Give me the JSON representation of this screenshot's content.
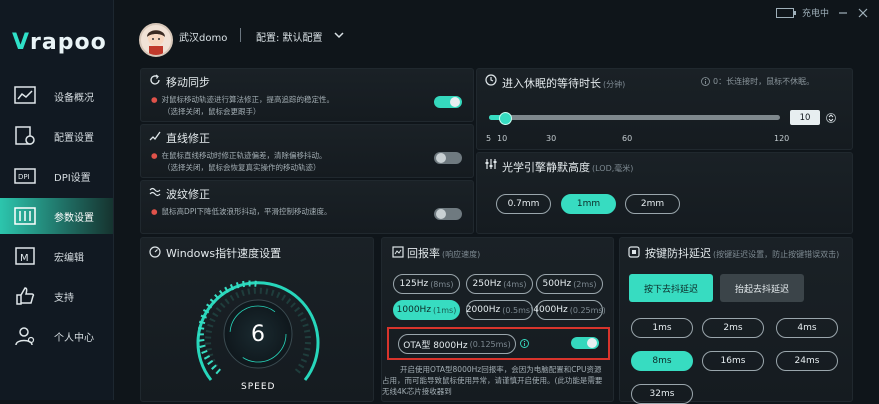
{
  "brand": {
    "logo": "rapoo",
    "logo_v": "V"
  },
  "topbar": {
    "battery_text": "充电中"
  },
  "header": {
    "username": "武汉domo",
    "config_label": "配置: 默认配置"
  },
  "sidebar": {
    "items": [
      {
        "label": "设备概况",
        "icon": "chart-icon"
      },
      {
        "label": "配置设置",
        "icon": "config-icon"
      },
      {
        "label": "DPI设置",
        "icon": "dpi-icon"
      },
      {
        "label": "参数设置",
        "icon": "params-icon"
      },
      {
        "label": "宏编辑",
        "icon": "macro-icon"
      },
      {
        "label": "支持",
        "icon": "thumb-icon"
      },
      {
        "label": "个人中心",
        "icon": "user-icon"
      }
    ]
  },
  "motion_sync": {
    "title": "移动同步",
    "desc1": "对鼠标移动轨迹进行算法修正，提高追踪的稳定性。",
    "desc2": "（选择关闭，鼠标会更跟手）",
    "enabled": true
  },
  "line_correction": {
    "title": "直线修正",
    "desc1": "在鼠标直线移动时修正轨迹偏差，清除偏移抖动。",
    "desc2": "（选择关闭，鼠标会恢复真实操作的移动轨迹）",
    "enabled": false
  },
  "ripple_correction": {
    "title": "波纹修正",
    "desc1": "鼠标高DPI下降低波浪形抖动，平滑控制移动速度。",
    "enabled": false
  },
  "sleep": {
    "title": "进入休眠的等待时长",
    "unit": "(分钟)",
    "hint": "0：长连接时，鼠标不休眠。",
    "value": "10",
    "ticks": [
      "5",
      "10",
      "30",
      "60",
      "120"
    ]
  },
  "lod": {
    "title": "光学引擎静默高度",
    "unit": "(LOD,毫米)",
    "options": [
      "0.7mm",
      "1mm",
      "2mm"
    ],
    "selected": 1
  },
  "pointer_speed": {
    "title": "Windows指针速度设置",
    "value": "6",
    "label": "SPEED"
  },
  "polling": {
    "title": "回报率",
    "subtitle": "(响应速度)",
    "options": [
      {
        "main": "125Hz",
        "sub": "(8ms)"
      },
      {
        "main": "250Hz",
        "sub": "(4ms)"
      },
      {
        "main": "500Hz",
        "sub": "(2ms)"
      },
      {
        "main": "1000Hz",
        "sub": "(1ms)"
      },
      {
        "main": "2000Hz",
        "sub": "(0.5ms)"
      },
      {
        "main": "4000Hz",
        "sub": "(0.25ms)"
      }
    ],
    "ota": {
      "main": "OTA型 8000Hz",
      "sub": "(0.125ms)",
      "enabled": true
    },
    "note": "开启使用OTA型8000Hz回报率，会因为电脑配置和CPU资源占用，而可能导致鼠标使用异常，请谨慎开启使用。(此功能是需要无线4K芯片接收器到"
  },
  "debounce": {
    "title": "按键防抖延迟",
    "subtitle": "(按键延迟设置，防止按键错误双击)",
    "mode_buttons": [
      "按下去抖延迟",
      "抬起去抖延迟"
    ],
    "mode_selected": 0,
    "values": [
      "1ms",
      "2ms",
      "4ms",
      "8ms",
      "16ms",
      "24ms",
      "32ms"
    ],
    "selected": 3
  },
  "colors": {
    "accent": "#37dcc1",
    "alert": "#e0524a"
  }
}
